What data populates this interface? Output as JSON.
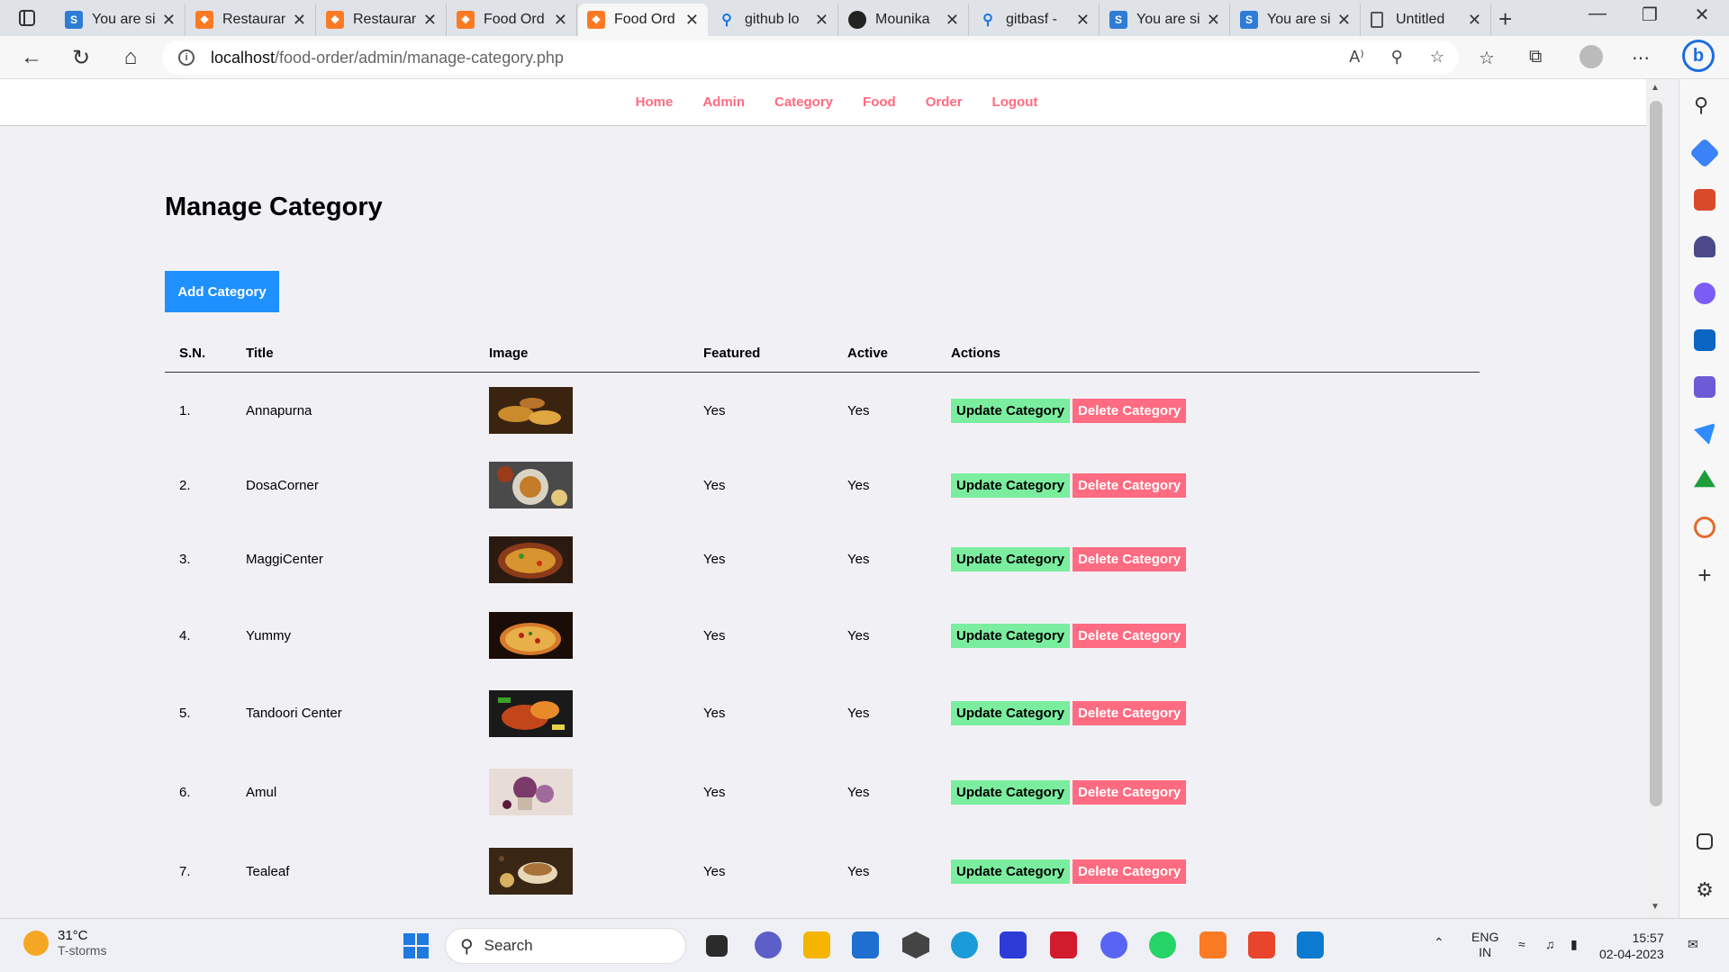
{
  "browser": {
    "tabs": [
      {
        "title": "You are si",
        "favicon": "s",
        "active": false
      },
      {
        "title": "Restauran",
        "favicon": "x",
        "active": false
      },
      {
        "title": "Restauran",
        "favicon": "x",
        "active": false
      },
      {
        "title": "Food Ord",
        "favicon": "x",
        "active": false
      },
      {
        "title": "Food Ord",
        "favicon": "x",
        "active": true
      },
      {
        "title": "github lo",
        "favicon": "q",
        "active": false
      },
      {
        "title": "Mounika",
        "favicon": "g",
        "active": false
      },
      {
        "title": "gitbasf -",
        "favicon": "q",
        "active": false
      },
      {
        "title": "You are si",
        "favicon": "s",
        "active": false
      },
      {
        "title": "You are si",
        "favicon": "s",
        "active": false
      },
      {
        "title": "Untitled",
        "favicon": "d",
        "active": false
      }
    ],
    "url_host": "localhost",
    "url_path": "/food-order/admin/manage-category.php"
  },
  "nav": {
    "links": [
      "Home",
      "Admin",
      "Category",
      "Food",
      "Order",
      "Logout"
    ]
  },
  "page": {
    "title": "Manage Category",
    "add_button": "Add Category",
    "columns": [
      "S.N.",
      "Title",
      "Image",
      "Featured",
      "Active",
      "Actions"
    ],
    "update_label": "Update Category",
    "delete_label": "Delete Category",
    "rows": [
      {
        "sn": "1.",
        "title": "Annapurna",
        "featured": "Yes",
        "active": "Yes",
        "image": "thali"
      },
      {
        "sn": "2.",
        "title": "DosaCorner",
        "featured": "Yes",
        "active": "Yes",
        "image": "dosa"
      },
      {
        "sn": "3.",
        "title": "MaggiCenter",
        "featured": "Yes",
        "active": "Yes",
        "image": "noodles"
      },
      {
        "sn": "4.",
        "title": "Yummy",
        "featured": "Yes",
        "active": "Yes",
        "image": "pizza"
      },
      {
        "sn": "5.",
        "title": "Tandoori Center",
        "featured": "Yes",
        "active": "Yes",
        "image": "tandoori"
      },
      {
        "sn": "6.",
        "title": "Amul",
        "featured": "Yes",
        "active": "Yes",
        "image": "icecream"
      },
      {
        "sn": "7.",
        "title": "Tealeaf",
        "featured": "Yes",
        "active": "Yes",
        "image": "tea"
      }
    ]
  },
  "taskbar": {
    "weather_temp": "31°C",
    "weather_desc": "T-storms",
    "search_label": "Search",
    "lang_line1": "ENG",
    "lang_line2": "IN",
    "time": "15:57",
    "date": "02-04-2023"
  },
  "colors": {
    "nav_link": "#ff6b81",
    "primary_button": "#1e90ff",
    "update_button": "#7bed9f",
    "delete_button": "#ff6b81"
  }
}
